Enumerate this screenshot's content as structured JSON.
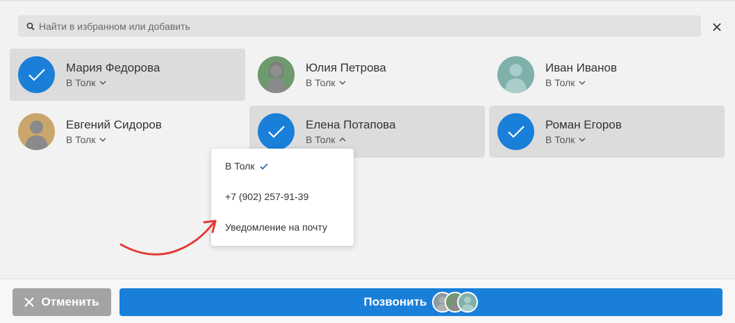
{
  "search": {
    "placeholder": "Найти в избранном или добавить"
  },
  "contacts": [
    {
      "name": "Мария Федорова",
      "channel": "В Толк",
      "selected": true,
      "avatar": "check-icon"
    },
    {
      "name": "Юлия Петрова",
      "channel": "В Толк",
      "selected": false,
      "avatar": "person-avatar",
      "color": "#6e9a6e"
    },
    {
      "name": "Иван Иванов",
      "channel": "В Толк",
      "selected": false,
      "avatar": "person-avatar",
      "color": "#7fb0ac"
    },
    {
      "name": "Евгений Сидоров",
      "channel": "В Толк",
      "selected": false,
      "avatar": "person-avatar",
      "color": "#c9a66b"
    },
    {
      "name": "Елена Потапова",
      "channel": "В Толк",
      "selected": true,
      "avatar": "check-icon",
      "dropdown_open": true
    },
    {
      "name": "Роман Егоров",
      "channel": "В Толк",
      "selected": true,
      "avatar": "check-icon"
    }
  ],
  "dropdown": {
    "items": [
      {
        "label": "В Толк",
        "checked": true
      },
      {
        "label": "+7 (902) 257-91-39",
        "checked": false
      },
      {
        "label": "Уведомление на почту",
        "checked": false
      }
    ]
  },
  "footer": {
    "cancel_label": "Отменить",
    "call_label": "Позвонить"
  },
  "colors": {
    "accent": "#1a7fd9",
    "cancel": "#a3a3a3",
    "arrow": "#e53935"
  }
}
